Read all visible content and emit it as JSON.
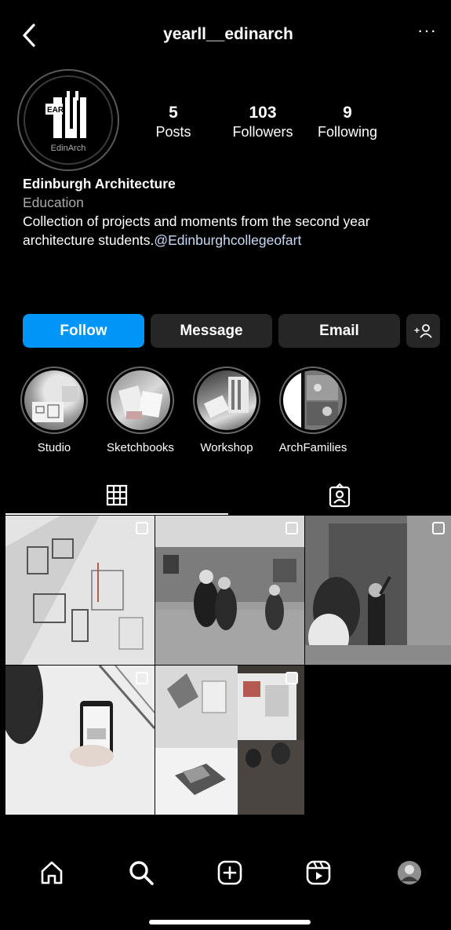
{
  "header": {
    "username": "yearll__edinarch",
    "more": "···"
  },
  "profile": {
    "logo_text": "EAR",
    "logo_subtitle": "EdinArch",
    "stats": [
      {
        "value": "5",
        "label": "Posts"
      },
      {
        "value": "103",
        "label": "Followers"
      },
      {
        "value": "9",
        "label": "Following"
      }
    ],
    "display_name": "Edinburgh Architecture",
    "category": "Education",
    "bio_line1": "Collection of projects and moments from the second year",
    "bio_line2_text": "architecture students.",
    "bio_mention": "@Edinburghcollegeofart"
  },
  "actions": {
    "follow": "Follow",
    "message": "Message",
    "email": "Email",
    "add_user": "+♂"
  },
  "highlights": [
    {
      "label": "Studio"
    },
    {
      "label": "Sketchbooks"
    },
    {
      "label": "Workshop"
    },
    {
      "label": "ArchFamilies"
    }
  ],
  "tabs": {
    "posts_icon": "grid-icon",
    "tagged_icon": "tagged-icon"
  },
  "posts": [
    {
      "type": "multi",
      "subject": "plans"
    },
    {
      "type": "multi",
      "subject": "students"
    },
    {
      "type": "multi",
      "subject": "wall"
    },
    {
      "type": "multi",
      "subject": "phone"
    },
    {
      "type": "multi",
      "subject": "models"
    }
  ],
  "nav": [
    "home-icon",
    "search-icon",
    "create-icon",
    "reels-icon",
    "profile-avatar"
  ],
  "colors": {
    "accent": "#0095f6",
    "button": "#262626",
    "background": "#000000"
  }
}
